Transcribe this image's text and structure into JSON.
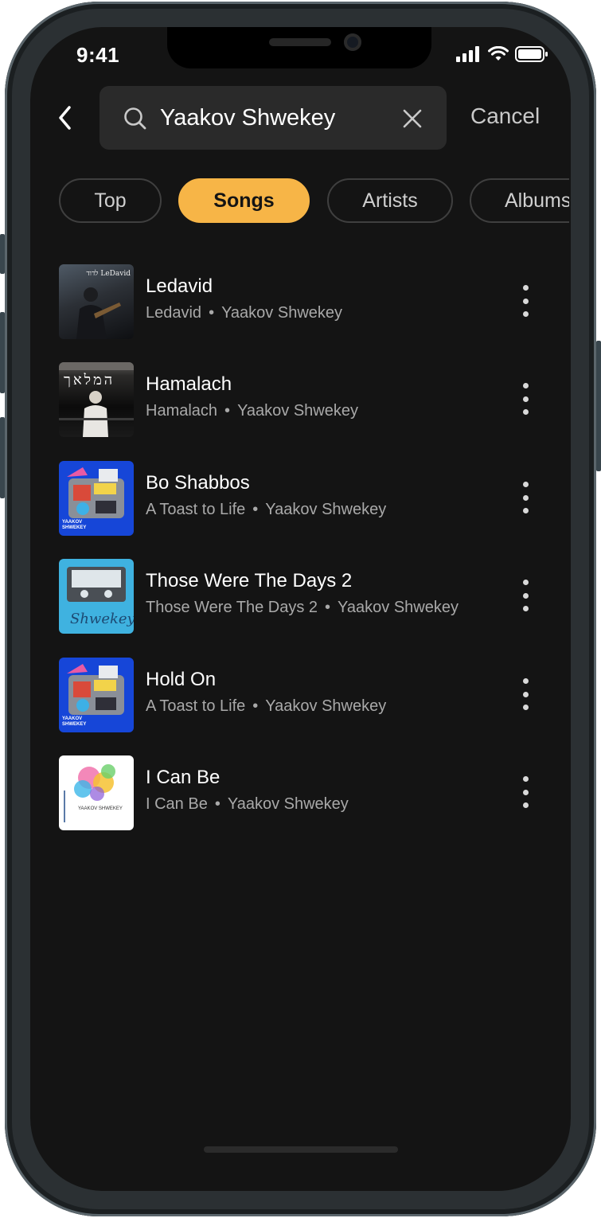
{
  "status_bar": {
    "time": "9:41"
  },
  "search": {
    "query": "Yaakov Shwekey",
    "cancel_label": "Cancel"
  },
  "tabs": [
    {
      "label": "Top",
      "active": false
    },
    {
      "label": "Songs",
      "active": true
    },
    {
      "label": "Artists",
      "active": false
    },
    {
      "label": "Albums",
      "active": false
    }
  ],
  "songs": [
    {
      "title": "Ledavid",
      "album": "Ledavid",
      "artist": "Yaakov Shwekey",
      "cover_text": "לדוד LeDavid"
    },
    {
      "title": "Hamalach",
      "album": "Hamalach",
      "artist": "Yaakov Shwekey",
      "cover_text": "המלאך"
    },
    {
      "title": "Bo Shabbos",
      "album": "A Toast to Life",
      "artist": "Yaakov Shwekey",
      "cover_text": "YAAKOV SHWEKEY"
    },
    {
      "title": "Those Were The Days 2",
      "album": "Those Were The Days 2",
      "artist": "Yaakov Shwekey",
      "cover_text": "Shwekey"
    },
    {
      "title": "Hold On",
      "album": "A Toast to Life",
      "artist": "Yaakov Shwekey",
      "cover_text": "YAAKOV SHWEKEY"
    },
    {
      "title": "I Can Be",
      "album": "I Can Be",
      "artist": "Yaakov Shwekey",
      "cover_text": "YAAKOV SHWEKEY"
    }
  ],
  "colors": {
    "accent": "#f7b547",
    "background": "#141414",
    "search_bg": "#2a2a2a"
  }
}
